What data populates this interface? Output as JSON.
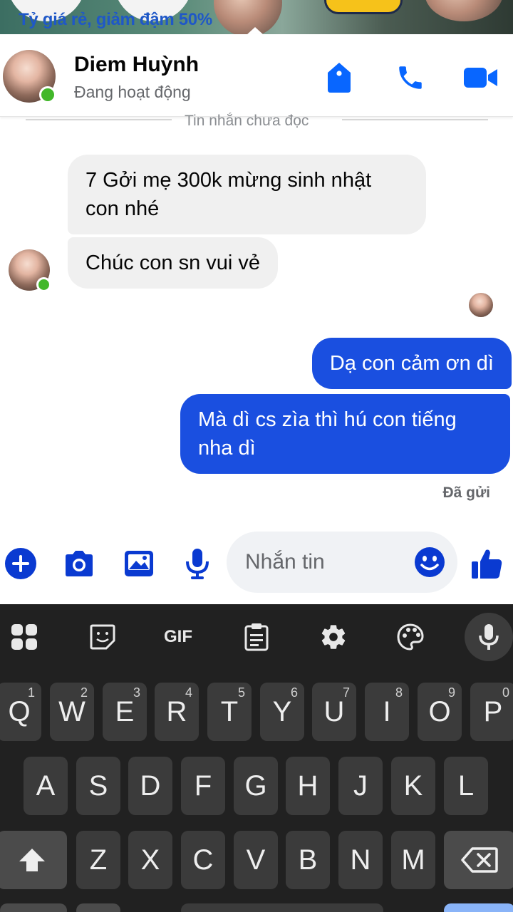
{
  "banner": {
    "text": "Tỷ giá rẻ, giảm đậm 50%"
  },
  "header": {
    "name": "Diem Huỳnh",
    "status": "Đang hoạt động",
    "actions": [
      "tag-icon",
      "phone-icon",
      "video-icon"
    ]
  },
  "divider": {
    "label": "Tin nhắn chưa đọc"
  },
  "messages": {
    "incoming": [
      {
        "text": "7 Gởi mẹ 300k mừng sinh nhật con nhé"
      },
      {
        "text": "Chúc con sn vui vẻ"
      }
    ],
    "outgoing": [
      {
        "text": "Dạ con cảm ơn dì"
      },
      {
        "text": "Mà dì cs zìa thì hú con tiếng nha dì"
      }
    ],
    "sent_status": "Đã gửi"
  },
  "composer": {
    "placeholder": "Nhắn tin",
    "buttons": [
      "plus-icon",
      "camera-icon",
      "image-icon",
      "mic-icon",
      "emoji-icon",
      "like-icon"
    ]
  },
  "keyboard": {
    "toolbar": {
      "gif_label": "GIF"
    },
    "row1": [
      {
        "label": "Q",
        "hint": "1"
      },
      {
        "label": "W",
        "hint": "2"
      },
      {
        "label": "E",
        "hint": "3"
      },
      {
        "label": "R",
        "hint": "4"
      },
      {
        "label": "T",
        "hint": "5"
      },
      {
        "label": "Y",
        "hint": "6"
      },
      {
        "label": "U",
        "hint": "7"
      },
      {
        "label": "I",
        "hint": "8"
      },
      {
        "label": "O",
        "hint": "9"
      },
      {
        "label": "P",
        "hint": "0"
      }
    ],
    "row2": [
      "A",
      "S",
      "D",
      "F",
      "G",
      "H",
      "J",
      "K",
      "L"
    ],
    "row3": [
      "Z",
      "X",
      "C",
      "V",
      "B",
      "N",
      "M"
    ]
  },
  "colors": {
    "accent": "#1a4fe0",
    "messenger_blue": "#0866ff",
    "online": "#42b72a",
    "keyboard_bg": "#212121",
    "key_bg": "#3b3b3b"
  }
}
